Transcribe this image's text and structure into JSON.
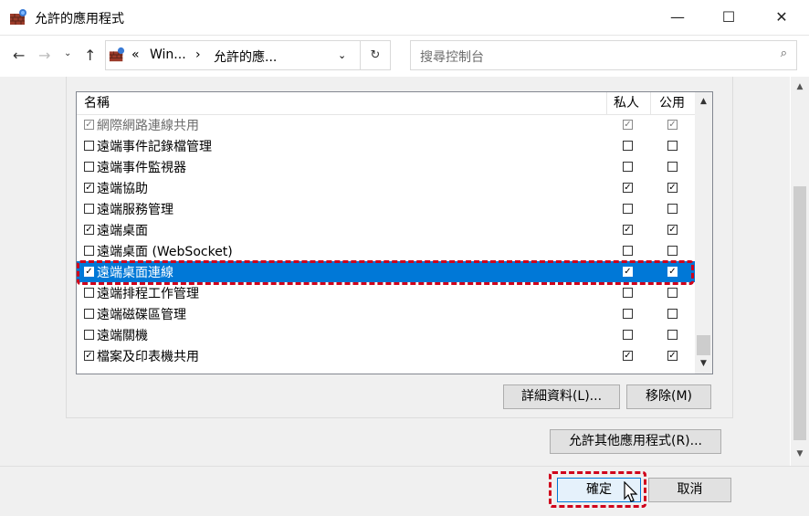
{
  "window": {
    "title": "允許的應用程式",
    "icon": "firewall-brick-icon",
    "controls": {
      "minimize": "—",
      "maximize": "☐",
      "close": "✕"
    }
  },
  "address": {
    "chevron": "«",
    "crumb1": "Win...",
    "sep": "›",
    "crumb2": "允許的應...",
    "search_placeholder": "搜尋控制台"
  },
  "list": {
    "headers": {
      "name": "名稱",
      "private": "私人",
      "public": "公用"
    },
    "rows": [
      {
        "name": "網際網路連線共用",
        "enabled": true,
        "private": true,
        "public": true,
        "state": "grey"
      },
      {
        "name": "遠端事件記錄檔管理",
        "enabled": false,
        "private": false,
        "public": false,
        "state": "normal"
      },
      {
        "name": "遠端事件監視器",
        "enabled": false,
        "private": false,
        "public": false,
        "state": "normal"
      },
      {
        "name": "遠端協助",
        "enabled": true,
        "private": true,
        "public": true,
        "state": "normal"
      },
      {
        "name": "遠端服務管理",
        "enabled": false,
        "private": false,
        "public": false,
        "state": "normal"
      },
      {
        "name": "遠端桌面",
        "enabled": true,
        "private": true,
        "public": true,
        "state": "normal"
      },
      {
        "name": "遠端桌面 (WebSocket)",
        "enabled": false,
        "private": false,
        "public": false,
        "state": "normal"
      },
      {
        "name": "遠端桌面連線",
        "enabled": true,
        "private": true,
        "public": true,
        "state": "selected"
      },
      {
        "name": "遠端排程工作管理",
        "enabled": false,
        "private": false,
        "public": false,
        "state": "normal"
      },
      {
        "name": "遠端磁碟區管理",
        "enabled": false,
        "private": false,
        "public": false,
        "state": "normal"
      },
      {
        "name": "遠端關機",
        "enabled": false,
        "private": false,
        "public": false,
        "state": "normal"
      },
      {
        "name": "檔案及印表機共用",
        "enabled": true,
        "private": true,
        "public": true,
        "state": "normal"
      }
    ]
  },
  "buttons": {
    "details": "詳細資料(L)...",
    "remove": "移除(M)",
    "allow_other": "允許其他應用程式(R)...",
    "ok": "確定",
    "cancel": "取消"
  },
  "colors": {
    "selection": "#0078d7",
    "highlight": "#d0021b"
  }
}
